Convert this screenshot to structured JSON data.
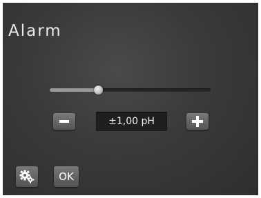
{
  "header": {
    "title": "Alarm"
  },
  "slider": {
    "value_fraction": 0.3
  },
  "stepper": {
    "decrement_icon": "minus-icon",
    "increment_icon": "plus-icon",
    "value_text": "±1,00 pH"
  },
  "footer": {
    "settings_icon": "gears-icon",
    "ok_label": "OK"
  },
  "colors": {
    "background": "#3a3a3a",
    "button": "#666666",
    "value_box": "#1f1f1f",
    "text": "#ffffff"
  }
}
